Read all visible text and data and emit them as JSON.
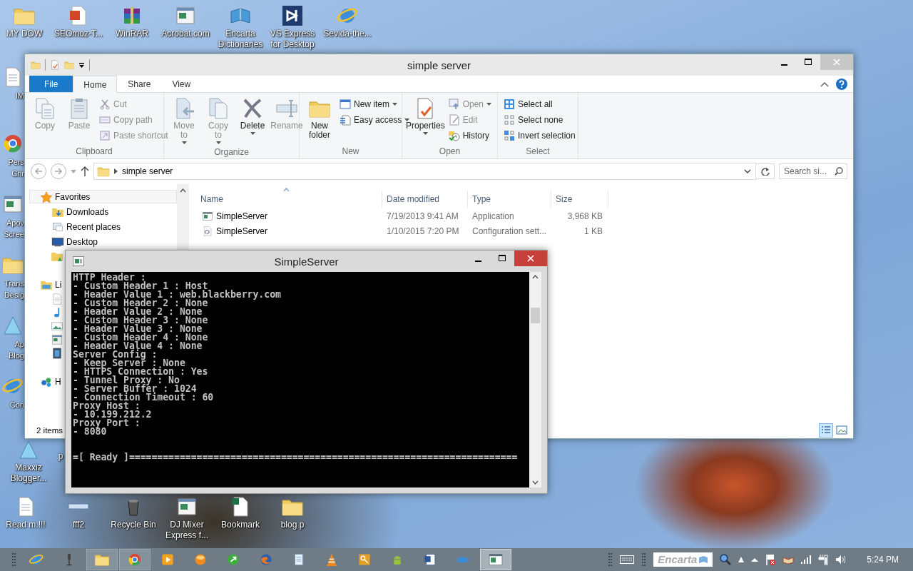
{
  "desktop": {
    "icons": [
      {
        "label": "MY DOW",
        "kind": "folder"
      },
      {
        "label": "SEOmoz-T...",
        "kind": "reddoc"
      },
      {
        "label": "WinRAR",
        "kind": "archive"
      },
      {
        "label": "Acrobat.com",
        "kind": "window"
      },
      {
        "label": "Encarta Dictionaries",
        "kind": "book"
      },
      {
        "label": "VS Express for Desktop",
        "kind": "vs"
      },
      {
        "label": "Sevida-the...",
        "kind": "ring"
      },
      {
        "label": "IM",
        "kind": "doc"
      },
      {
        "label": "Pers Chr",
        "kind": "chrome"
      },
      {
        "label": "Apov Scree",
        "kind": "window"
      },
      {
        "label": "Trans Desig",
        "kind": "folder"
      },
      {
        "label": "Ap Blog",
        "kind": "triangle"
      },
      {
        "label": "Con",
        "kind": "ring"
      },
      {
        "label": "Maxxiz Blogger...",
        "kind": "triangle"
      },
      {
        "label": "p",
        "kind": "none"
      },
      {
        "label": "Read m.!!!",
        "kind": "doc"
      },
      {
        "label": "fff2",
        "kind": "strip"
      },
      {
        "label": "Recycle Bin",
        "kind": "bin"
      },
      {
        "label": "DJ Mixer Express f...",
        "kind": "window"
      },
      {
        "label": "Bookmark",
        "kind": "sheet"
      },
      {
        "label": "blog p",
        "kind": "folder"
      }
    ]
  },
  "explorer": {
    "title": "simple server",
    "tabs": [
      {
        "label": "File",
        "kind": "file",
        "selected": false
      },
      {
        "label": "Home",
        "kind": "tab",
        "selected": true
      },
      {
        "label": "Share",
        "kind": "tab",
        "selected": false
      },
      {
        "label": "View",
        "kind": "tab",
        "selected": false
      }
    ],
    "ribbon": {
      "groups": [
        {
          "label": "Clipboard",
          "items": [
            {
              "label": "Copy",
              "kind": "large",
              "disabled": true,
              "dropdown": false
            },
            {
              "label": "Paste",
              "kind": "large",
              "disabled": true,
              "dropdown": false
            },
            {
              "label": "Cut",
              "kind": "small",
              "disabled": true,
              "dropdown": false
            },
            {
              "label": "Copy path",
              "kind": "small",
              "disabled": true,
              "dropdown": false
            },
            {
              "label": "Paste shortcut",
              "kind": "small",
              "disabled": true,
              "dropdown": false
            }
          ]
        },
        {
          "label": "Organize",
          "items": [
            {
              "label": "Move to",
              "kind": "large",
              "disabled": true,
              "dropdown": true
            },
            {
              "label": "Copy to",
              "kind": "large",
              "disabled": true,
              "dropdown": true
            },
            {
              "label": "Delete",
              "kind": "large",
              "disabled": false,
              "dropdown": true
            },
            {
              "label": "Rename",
              "kind": "large",
              "disabled": true,
              "dropdown": false
            }
          ]
        },
        {
          "label": "New",
          "items": [
            {
              "label": "New folder",
              "kind": "large",
              "disabled": false,
              "dropdown": false
            },
            {
              "label": "New item",
              "kind": "small",
              "disabled": false,
              "dropdown": true
            },
            {
              "label": "Easy access",
              "kind": "small",
              "disabled": false,
              "dropdown": true
            }
          ]
        },
        {
          "label": "Open",
          "items": [
            {
              "label": "Properties",
              "kind": "large",
              "disabled": false,
              "dropdown": true
            },
            {
              "label": "Open",
              "kind": "small",
              "disabled": true,
              "dropdown": true
            },
            {
              "label": "Edit",
              "kind": "small",
              "disabled": true,
              "dropdown": false
            },
            {
              "label": "History",
              "kind": "small",
              "disabled": false,
              "dropdown": false
            }
          ]
        },
        {
          "label": "Select",
          "items": [
            {
              "label": "Select all",
              "kind": "small",
              "disabled": false,
              "dropdown": false
            },
            {
              "label": "Select none",
              "kind": "small",
              "disabled": false,
              "dropdown": false
            },
            {
              "label": "Invert selection",
              "kind": "small",
              "disabled": false,
              "dropdown": false
            }
          ]
        }
      ]
    },
    "address": {
      "path": "simple server",
      "search": {
        "placeholder": "Search si..."
      }
    },
    "nav": [
      {
        "label": "Favorites",
        "kind": "star",
        "selected": true,
        "children": [
          {
            "label": "Downloads",
            "kind": "downloads",
            "selected": false
          },
          {
            "label": "Recent places",
            "kind": "recent",
            "selected": false
          },
          {
            "label": "Desktop",
            "kind": "desktop",
            "selected": false
          },
          {
            "kind": "drive"
          }
        ]
      },
      {
        "label": "Li",
        "kind": "library",
        "selected": false,
        "children": [
          {
            "kind": "doc"
          },
          {
            "kind": "music"
          },
          {
            "kind": "picture"
          },
          {
            "kind": "window"
          },
          {
            "kind": "video"
          }
        ]
      },
      {
        "label": "H",
        "kind": "homegroup",
        "selected": false
      }
    ],
    "columns": [
      {
        "label": "Name",
        "sorted": true
      },
      {
        "label": "Date modified",
        "sorted": false
      },
      {
        "label": "Type",
        "sorted": false
      },
      {
        "label": "Size",
        "sorted": false
      }
    ],
    "rows": [
      {
        "kind": "app",
        "name": "SimpleServer",
        "date": "7/19/2013 9:41 AM",
        "type": "Application",
        "size": "3,968 KB"
      },
      {
        "kind": "config",
        "name": "SimpleServer",
        "date": "1/10/2015 7:20 PM",
        "type": "Configuration sett...",
        "size": "1 KB"
      }
    ],
    "status": "2 items",
    "views": [
      {
        "kind": "details",
        "selected": true
      },
      {
        "kind": "tiles",
        "selected": false
      }
    ]
  },
  "console": {
    "title": "SimpleServer",
    "lines": [
      "HTTP Header :",
      "- Custom Header 1 : Host",
      "- Header Value 1 : web.blackberry.com",
      "- Custom Header 2 : None",
      "- Header Value 2 : None",
      "- Custom Header 3 : None",
      "- Header Value 3 : None",
      "- Custom Header 4 : None",
      "- Header Value 4 : None",
      "Server Config :",
      "- Keep Server : None",
      "- HTTPS Connection : Yes",
      "- Tunnel Proxy : No",
      "- Server Buffer : 1024",
      "- Connection Timeout : 60",
      "Proxy Host :",
      "- 10.199.212.2",
      "Proxy Port :",
      "- 8080"
    ],
    "ready_line": "=[ Ready ]====================================================================="
  },
  "taskbar": {
    "apps": [
      {
        "kind": "ring",
        "running": false,
        "selected": false
      },
      {
        "kind": "mic",
        "running": false,
        "selected": false
      },
      {
        "kind": "folder",
        "running": true,
        "selected": false
      },
      {
        "kind": "chrome",
        "running": true,
        "selected": false
      },
      {
        "kind": "play",
        "running": false,
        "selected": false
      },
      {
        "kind": "ball",
        "running": false,
        "selected": false
      },
      {
        "kind": "greenarrow",
        "running": false,
        "selected": false
      },
      {
        "kind": "fox",
        "running": false,
        "selected": false
      },
      {
        "kind": "notepad",
        "running": false,
        "selected": false
      },
      {
        "kind": "cone",
        "running": false,
        "selected": false
      },
      {
        "kind": "key",
        "running": false,
        "selected": false
      },
      {
        "kind": "android",
        "running": false,
        "selected": false
      },
      {
        "kind": "word",
        "running": false,
        "selected": false
      },
      {
        "kind": "camera",
        "running": false,
        "selected": false
      },
      {
        "kind": "window",
        "running": true,
        "selected": true
      }
    ],
    "toolbar_label": "Encarta",
    "clock": "5:24 PM"
  }
}
